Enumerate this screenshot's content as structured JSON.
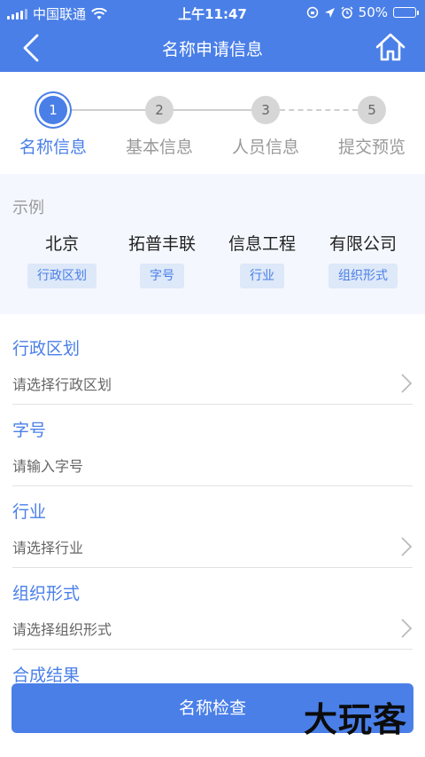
{
  "status_bar": {
    "carrier": "中国联通",
    "time": "上午11:47",
    "battery": "50%",
    "battery_level": 0.5
  },
  "nav": {
    "title": "名称申请信息"
  },
  "steps": [
    {
      "number": "1",
      "label": "名称信息",
      "active": true
    },
    {
      "number": "2",
      "label": "基本信息",
      "active": false
    },
    {
      "number": "3",
      "label": "人员信息",
      "active": false
    },
    {
      "number": "5",
      "label": "提交预览",
      "active": false
    }
  ],
  "example": {
    "title": "示例",
    "items": [
      {
        "word": "北京",
        "tag": "行政区划"
      },
      {
        "word": "拓普丰联",
        "tag": "字号"
      },
      {
        "word": "信息工程",
        "tag": "行业"
      },
      {
        "word": "有限公司",
        "tag": "组织形式"
      }
    ]
  },
  "fields": [
    {
      "label": "行政区划",
      "placeholder": "请选择行政区划",
      "has_arrow": true
    },
    {
      "label": "字号",
      "placeholder": "请输入字号",
      "has_arrow": false
    },
    {
      "label": "行业",
      "placeholder": "请选择行业",
      "has_arrow": true
    },
    {
      "label": "组织形式",
      "placeholder": "请选择组织形式",
      "has_arrow": true
    },
    {
      "label": "合成结果",
      "placeholder": "",
      "has_arrow": false
    }
  ],
  "button": {
    "label": "名称检查"
  },
  "watermark": "大玩客",
  "colors": {
    "primary": "#4a7fe8",
    "tag_bg": "#dde8f8",
    "example_bg": "#f4f8fe"
  }
}
